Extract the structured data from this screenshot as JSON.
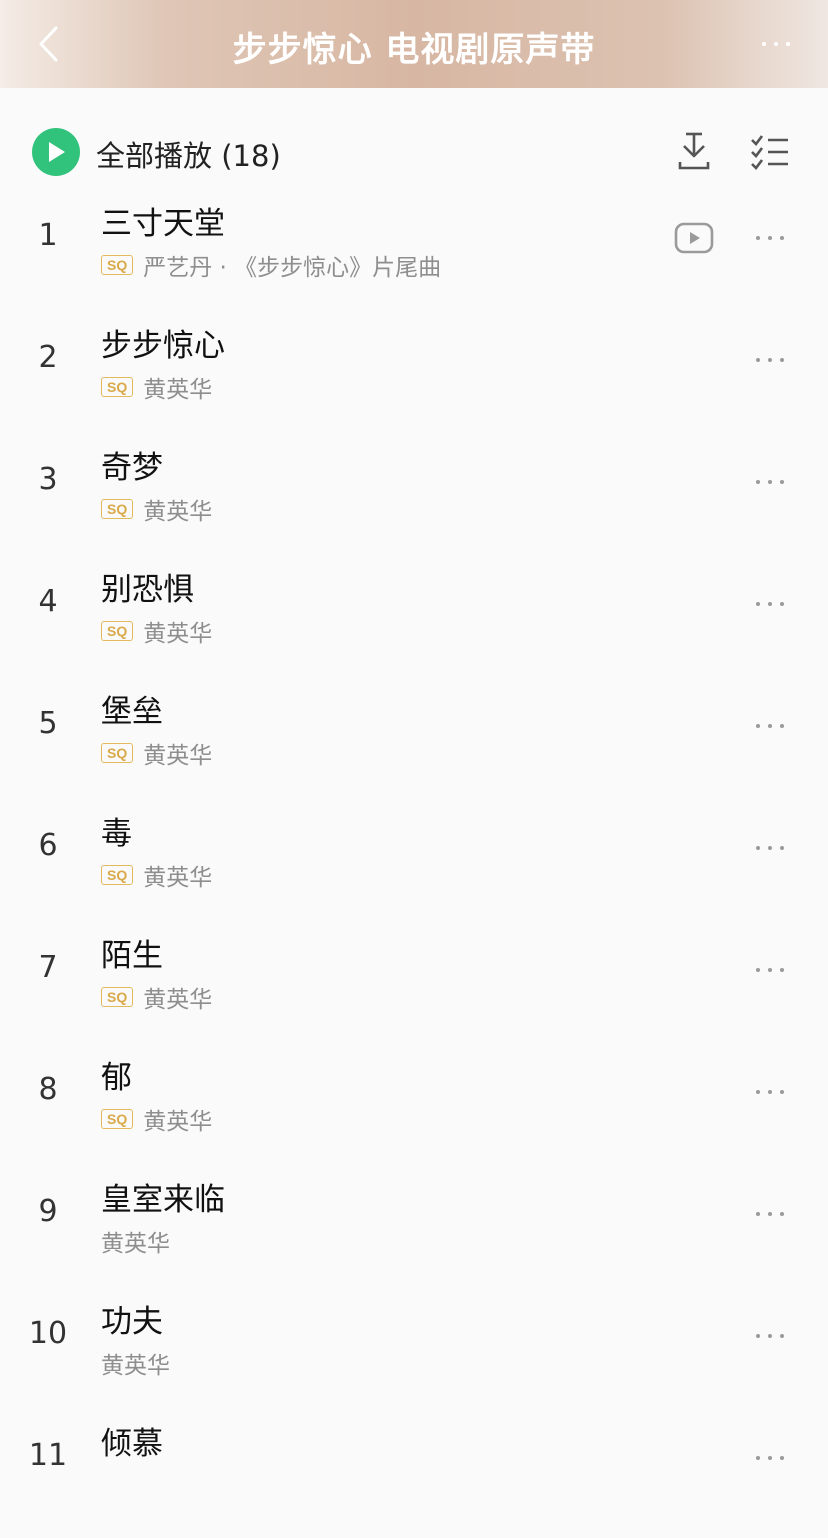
{
  "header": {
    "title": "步步惊心 电视剧原声带",
    "back_icon": "chevron-left-icon",
    "more_icon": "more-horizontal-icon"
  },
  "toolbar": {
    "play_all_label": "全部播放",
    "count": "(18)",
    "play_all_label_full": "全部播放 (18)",
    "accent_color": "#31c27c"
  },
  "songs": [
    {
      "index": "1",
      "title": "三寸天堂",
      "sq": true,
      "sq_label": "SQ",
      "subtitle": "严艺丹 · 《步步惊心》片尾曲",
      "has_mv": true
    },
    {
      "index": "2",
      "title": "步步惊心",
      "sq": true,
      "sq_label": "SQ",
      "subtitle": "黄英华"
    },
    {
      "index": "3",
      "title": "奇梦",
      "sq": true,
      "sq_label": "SQ",
      "subtitle": "黄英华"
    },
    {
      "index": "4",
      "title": "别恐惧",
      "sq": true,
      "sq_label": "SQ",
      "subtitle": "黄英华"
    },
    {
      "index": "5",
      "title": "堡垒",
      "sq": true,
      "sq_label": "SQ",
      "subtitle": "黄英华"
    },
    {
      "index": "6",
      "title": "毒",
      "sq": true,
      "sq_label": "SQ",
      "subtitle": "黄英华"
    },
    {
      "index": "7",
      "title": "陌生",
      "sq": true,
      "sq_label": "SQ",
      "subtitle": "黄英华"
    },
    {
      "index": "8",
      "title": "郁",
      "sq": true,
      "sq_label": "SQ",
      "subtitle": "黄英华"
    },
    {
      "index": "9",
      "title": "皇室来临",
      "sq": false,
      "subtitle": "黄英华"
    },
    {
      "index": "10",
      "title": "功夫",
      "sq": false,
      "subtitle": "黄英华"
    },
    {
      "index": "11",
      "title": "倾慕",
      "sq": false,
      "subtitle": ""
    }
  ]
}
